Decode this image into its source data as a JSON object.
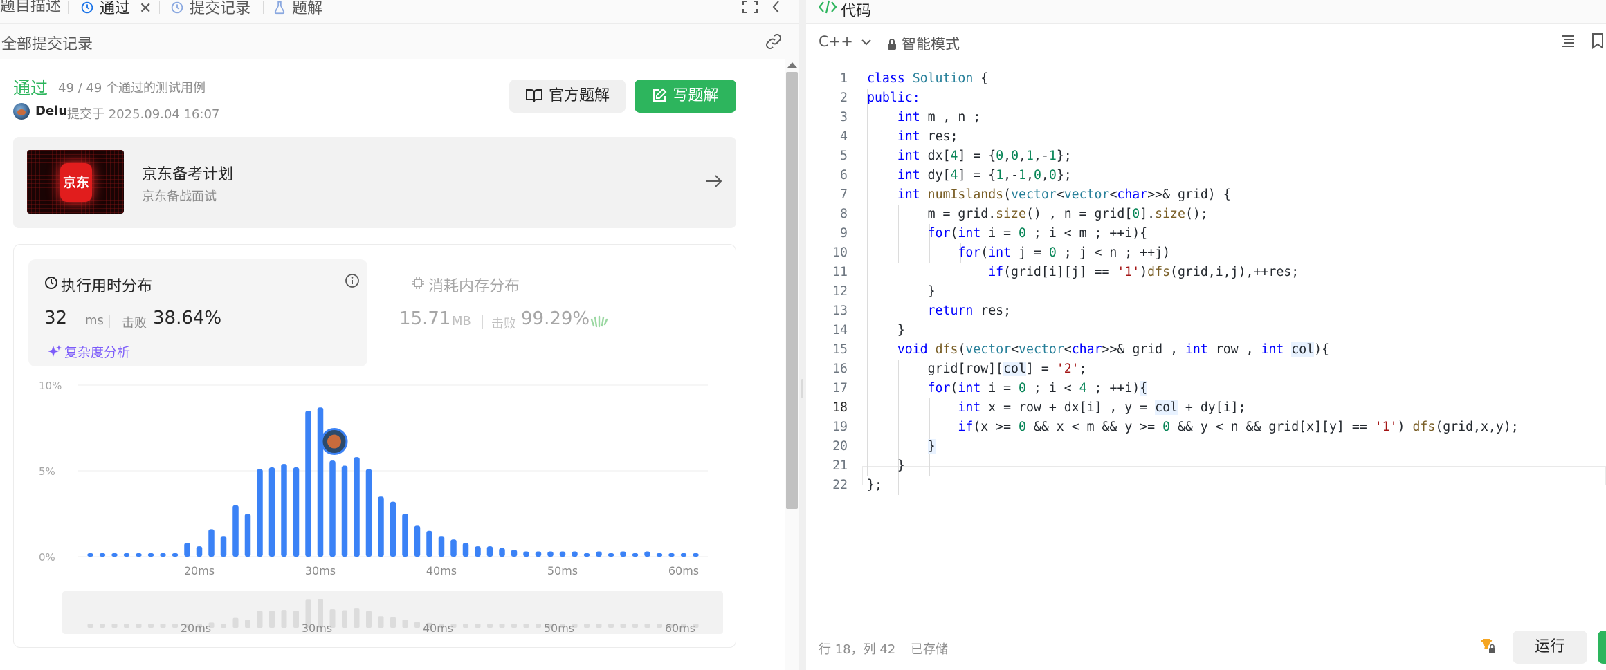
{
  "tabs": [
    {
      "label": "题目描述"
    },
    {
      "label": "通过"
    },
    {
      "label": "提交记录"
    },
    {
      "label": "题解"
    }
  ],
  "submission": {
    "section_title": "全部提交记录",
    "status": "通过",
    "cases": "49 / 49 个通过的测试用例",
    "user": "Delu",
    "submitted": "提交于 2025.09.04 16:07",
    "btn_official": "官方题解",
    "btn_write": "写题解"
  },
  "promo": {
    "logo_text": "京东",
    "title": "京东备考计划",
    "subtitle": "京东备战面试"
  },
  "runtime": {
    "title": "执行用时分布",
    "value": "32",
    "unit": "ms",
    "beats_label": "击败",
    "beats": "38.64%",
    "complexity_link": "复杂度分析"
  },
  "memory": {
    "title": "消耗内存分布",
    "value": "15.71",
    "unit": "MB",
    "beats_label": "击败",
    "beats": "99.29%"
  },
  "chart_data": {
    "type": "bar",
    "y_ticks": [
      "0%",
      "5%",
      "10%"
    ],
    "ylim": [
      0,
      10
    ],
    "x_ticks": [
      "20ms",
      "30ms",
      "40ms",
      "50ms",
      "60ms"
    ],
    "x_tick_values": [
      20,
      30,
      40,
      50,
      60
    ],
    "xlim": [
      10,
      62
    ],
    "x": [
      11,
      12,
      13,
      14,
      15,
      16,
      17,
      18,
      19,
      20,
      21,
      22,
      23,
      24,
      25,
      26,
      27,
      28,
      29,
      30,
      31,
      32,
      33,
      34,
      35,
      36,
      37,
      38,
      39,
      40,
      41,
      42,
      43,
      44,
      45,
      46,
      47,
      48,
      49,
      50,
      51,
      52,
      53,
      54,
      55,
      56,
      57,
      58,
      59,
      60,
      61
    ],
    "values": [
      0.2,
      0.2,
      0.2,
      0.2,
      0.2,
      0.2,
      0.2,
      0.2,
      0.8,
      0.6,
      1.6,
      1.2,
      3.0,
      2.5,
      5.1,
      5.2,
      5.4,
      5.2,
      8.5,
      8.7,
      5.6,
      5.3,
      5.8,
      5.1,
      3.5,
      3.2,
      2.5,
      1.8,
      1.5,
      1.2,
      1.0,
      0.8,
      0.6,
      0.6,
      0.5,
      0.4,
      0.3,
      0.3,
      0.3,
      0.3,
      0.3,
      0.2,
      0.3,
      0.2,
      0.3,
      0.2,
      0.3,
      0.2,
      0.2,
      0.2,
      0.2
    ],
    "marker_x": 32
  },
  "editor": {
    "title": "代码",
    "language": "C++",
    "mode": "智能模式",
    "cursor_pos": "行 18，列 42",
    "save_status": "已存储",
    "run_label": "运行"
  }
}
